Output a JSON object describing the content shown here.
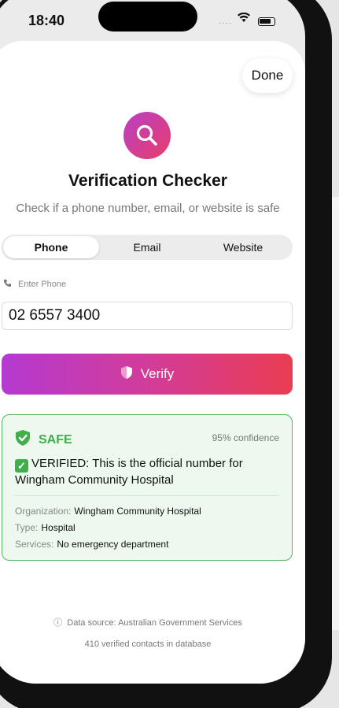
{
  "status": {
    "time": "18:40"
  },
  "done_label": "Done",
  "title": "Verification Checker",
  "subtitle": "Check if a phone number, email, or website is safe",
  "tabs": [
    {
      "label": "Phone",
      "active": true
    },
    {
      "label": "Email",
      "active": false
    },
    {
      "label": "Website",
      "active": false
    }
  ],
  "field": {
    "label": "Enter Phone",
    "value": "02 6557 3400"
  },
  "verify_label": "Verify",
  "result": {
    "status": "SAFE",
    "confidence": "95% confidence",
    "message": "VERIFIED: This is the official number for Wingham Community Hospital",
    "details": [
      {
        "key": "Organization:",
        "value": "Wingham Community Hospital"
      },
      {
        "key": "Type:",
        "value": "Hospital"
      },
      {
        "key": "Services:",
        "value": "No emergency department"
      }
    ]
  },
  "footer": {
    "source": "Data source: Australian Government Services",
    "count": "410 verified contacts in database"
  },
  "colors": {
    "accent_start": "#b43ad0",
    "accent_end": "#ea3c52",
    "safe": "#3fae4b"
  }
}
